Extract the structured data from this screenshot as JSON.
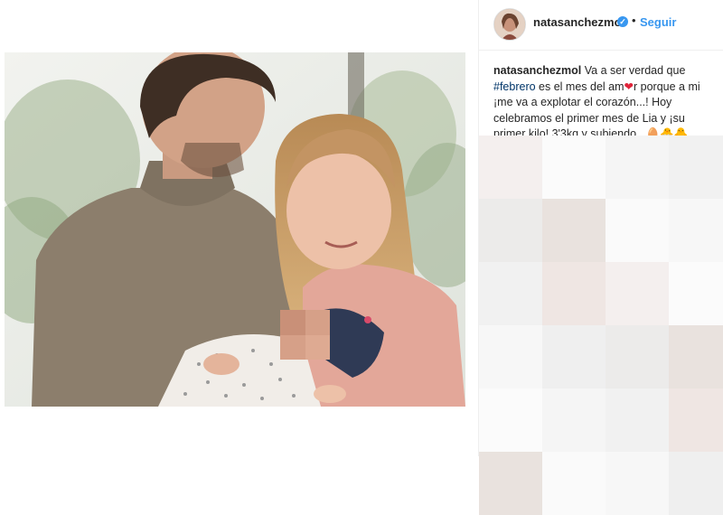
{
  "post": {
    "username": "natasanchezmol",
    "verified_badge": "✓",
    "separator": "•",
    "follow_label": "Seguir"
  },
  "caption": {
    "username": "natasanchezmol",
    "part1": "Va a ser verdad que",
    "hashtag": "#febrero",
    "part2": "es el mes del am",
    "heart": "❤",
    "part3": "r porque a mi ¡me va a explotar el corazón...! Hoy celebramos el primer mes de Lia y ¡su primer kilo! 3'3kg y subiendo...",
    "emojis": "🥚🐣🐥"
  },
  "icons": {
    "verified": "verified-badge-icon",
    "heart": "heart-icon"
  },
  "colors": {
    "link": "#3897f0",
    "hashtag": "#003569",
    "text": "#262626",
    "heart": "#e0243a"
  }
}
